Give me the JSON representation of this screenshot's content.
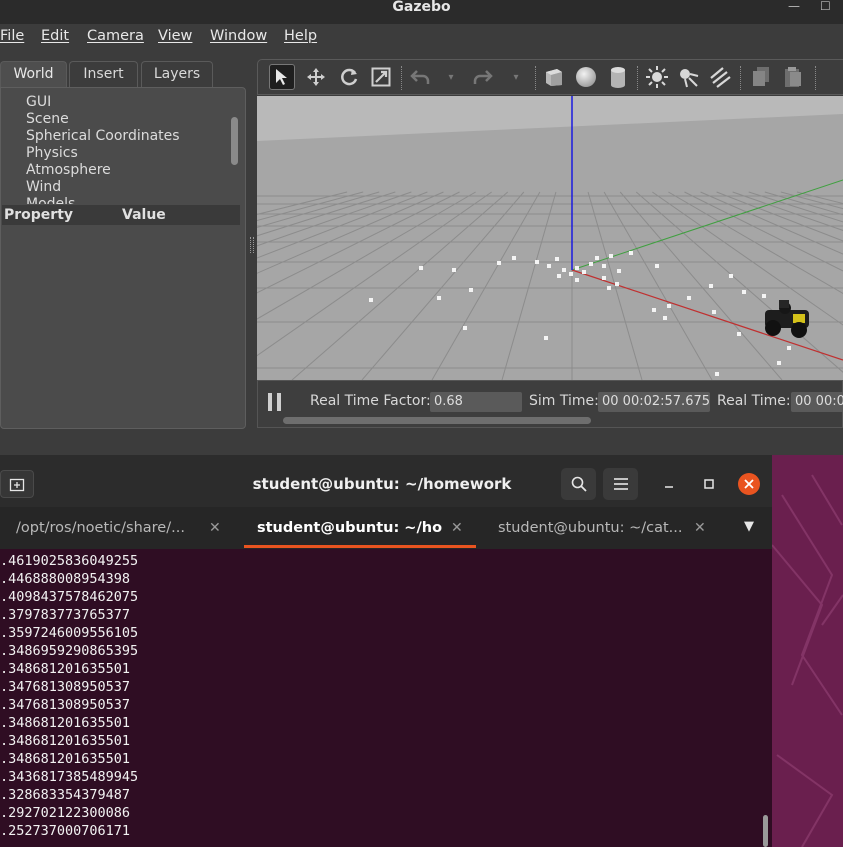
{
  "gazebo": {
    "title": "Gazebo",
    "menu": [
      "File",
      "Edit",
      "Camera",
      "View",
      "Window",
      "Help"
    ],
    "tabs": [
      "World",
      "Insert",
      "Layers"
    ],
    "active_tab": "World",
    "tree_items": [
      "GUI",
      "Scene",
      "Spherical Coordinates",
      "Physics",
      "Atmosphere",
      "Wind",
      "Models"
    ],
    "property_header": {
      "property": "Property",
      "value": "Value"
    },
    "toolbar_icons": [
      "select-arrow-icon",
      "translate-icon",
      "rotate-icon",
      "scale-icon",
      "undo-icon",
      "undo-history-icon",
      "redo-icon",
      "redo-history-icon",
      "box-icon",
      "sphere-icon",
      "cylinder-icon",
      "point-light-icon",
      "spot-light-icon",
      "directional-light-icon",
      "copy-icon",
      "paste-icon"
    ],
    "sim": {
      "real_time_factor_label": "Real Time Factor:",
      "real_time_factor": "0.68",
      "sim_time_label": "Sim Time:",
      "sim_time": "00 00:02:57.675",
      "real_time_label": "Real Time:",
      "real_time": "00 00:0"
    }
  },
  "terminal": {
    "title": "student@ubuntu: ~/homework",
    "tabs": [
      {
        "label": "/opt/ros/noetic/share/...",
        "active": false
      },
      {
        "label": "student@ubuntu: ~/ho...",
        "active": true
      },
      {
        "label": "student@ubuntu: ~/cat...",
        "active": false
      }
    ],
    "lines": [
      ".4619025836049255",
      ".446888008954398",
      ".4098437578462075",
      ".379783773765377",
      ".3597246009556105",
      ".3486959290865395",
      ".348681201635501",
      ".347681308950537",
      ".347681308950537",
      ".348681201635501",
      ".348681201635501",
      ".348681201635501",
      ".3436817385489945",
      ".328683354379487",
      ".292702122300086",
      ".252737000706171"
    ]
  },
  "colors": {
    "terminal_bg": "#2f0d23",
    "accent": "#e95420",
    "close_button": "#e95420",
    "desktop": "#6a1f4e",
    "viewport_ground": "#a6a6a6"
  }
}
